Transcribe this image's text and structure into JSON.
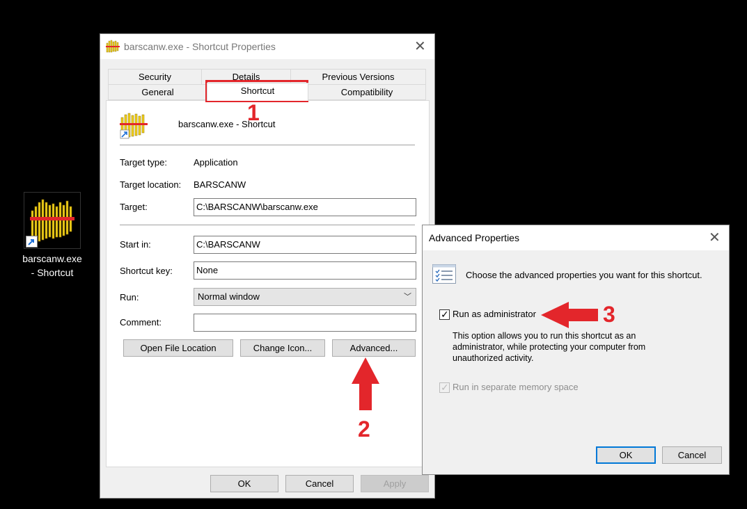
{
  "desktop": {
    "icon_label_line1": "barscanw.exe",
    "icon_label_line2": "- Shortcut"
  },
  "main_dialog": {
    "title": "barscanw.exe - Shortcut Properties",
    "tabs": [
      {
        "label": "Security"
      },
      {
        "label": "Details"
      },
      {
        "label": "Previous Versions"
      },
      {
        "label": "General"
      },
      {
        "label": "Shortcut"
      },
      {
        "label": "Compatibility"
      }
    ],
    "header_name": "barscanw.exe - Shortcut",
    "target_type_label": "Target type:",
    "target_type_value": "Application",
    "target_location_label": "Target location:",
    "target_location_value": "BARSCANW",
    "target_label": "Target:",
    "target_value": "C:\\BARSCANW\\barscanw.exe",
    "start_in_label": "Start in:",
    "start_in_value": "C:\\BARSCANW",
    "shortcut_key_label": "Shortcut key:",
    "shortcut_key_value": "None",
    "run_label": "Run:",
    "run_value": "Normal window",
    "comment_label": "Comment:",
    "comment_value": "",
    "open_file_location": "Open File Location",
    "change_icon": "Change Icon...",
    "advanced": "Advanced...",
    "ok": "OK",
    "cancel": "Cancel",
    "apply": "Apply"
  },
  "advanced_dialog": {
    "title": "Advanced Properties",
    "description": "Choose the advanced properties you want for this shortcut.",
    "run_as_admin_label": "Run as administrator",
    "run_as_admin_checked": true,
    "help_line1": "This option allows you to run this shortcut as an",
    "help_line2": "administrator, while protecting your computer from",
    "help_line3": "unauthorized activity.",
    "separate_memory_label": "Run in separate memory space",
    "separate_memory_checked": true,
    "ok": "OK",
    "cancel": "Cancel"
  },
  "annotations": {
    "step1": "1",
    "step2": "2",
    "step3": "3"
  },
  "colors": {
    "annotation": "#e3262b",
    "accent": "#0078d7",
    "barcode_yellow": "#f2d21b"
  },
  "icons": {
    "app": "barcode-scanner-icon",
    "shortcut_overlay": "shortcut-arrow-icon",
    "close": "close-icon",
    "dropdown": "chevron-down-icon",
    "properties": "checklist-icon"
  }
}
